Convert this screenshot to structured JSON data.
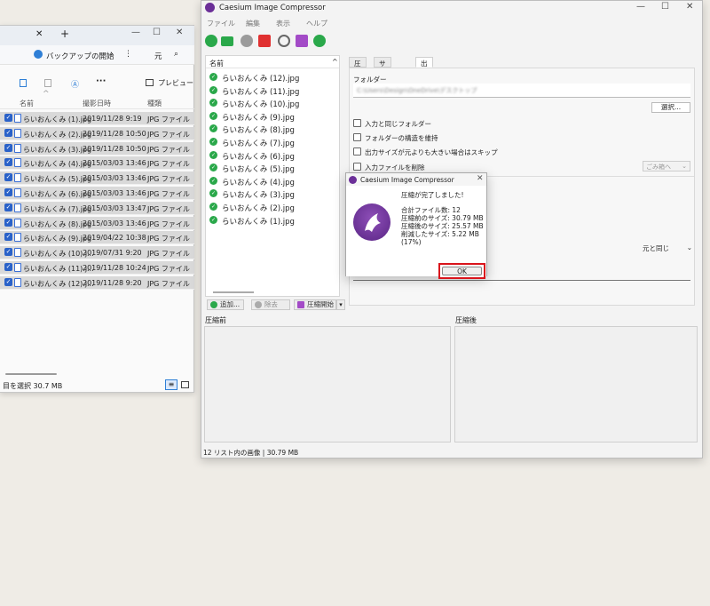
{
  "explorer": {
    "address_crumb": "バックアップの開始",
    "address_right": "元",
    "preview_label": "プレビュー",
    "toolbar_more": "···",
    "columns": [
      "名前",
      "撮影日時",
      "種類"
    ],
    "files": [
      {
        "name": "らいおんくみ (1).jpg",
        "date": "2019/11/28 9:19",
        "type": "JPG ファイル"
      },
      {
        "name": "らいおんくみ (2).jpg",
        "date": "2019/11/28 10:50",
        "type": "JPG ファイル"
      },
      {
        "name": "らいおんくみ (3).jpg",
        "date": "2019/11/28 10:50",
        "type": "JPG ファイル"
      },
      {
        "name": "らいおんくみ (4).jpg",
        "date": "2015/03/03 13:46",
        "type": "JPG ファイル"
      },
      {
        "name": "らいおんくみ (5).jpg",
        "date": "2015/03/03 13:46",
        "type": "JPG ファイル"
      },
      {
        "name": "らいおんくみ (6).jpg",
        "date": "2015/03/03 13:46",
        "type": "JPG ファイル"
      },
      {
        "name": "らいおんくみ (7).jpg",
        "date": "2015/03/03 13:47",
        "type": "JPG ファイル"
      },
      {
        "name": "らいおんくみ (8).jpg",
        "date": "2015/03/03 13:46",
        "type": "JPG ファイル"
      },
      {
        "name": "らいおんくみ (9).jpg",
        "date": "2019/04/22 10:38",
        "type": "JPG ファイル"
      },
      {
        "name": "らいおんくみ (10).j...",
        "date": "2019/07/31 9:20",
        "type": "JPG ファイル"
      },
      {
        "name": "らいおんくみ (11).j...",
        "date": "2019/11/28 10:24",
        "type": "JPG ファイル"
      },
      {
        "name": "らいおんくみ (12).j...",
        "date": "2019/11/28 9:20",
        "type": "JPG ファイル"
      }
    ],
    "status": "目を選択  30.7 MB"
  },
  "caesium": {
    "title": "Caesium Image Compressor",
    "menu": [
      "ファイル",
      "編集",
      "表示",
      "ヘルプ"
    ],
    "list_header": "名前",
    "list_items": [
      "らいおんくみ (12).jpg",
      "らいおんくみ (11).jpg",
      "らいおんくみ (10).jpg",
      "らいおんくみ (9).jpg",
      "らいおんくみ (8).jpg",
      "らいおんくみ (7).jpg",
      "らいおんくみ (6).jpg",
      "らいおんくみ (5).jpg",
      "らいおんくみ (4).jpg",
      "らいおんくみ (3).jpg",
      "らいおんくみ (2).jpg",
      "らいおんくみ (1).jpg"
    ],
    "btn_add": "追加...",
    "btn_remove": "除去",
    "btn_compress": "圧縮開始",
    "tabs": [
      "圧縮",
      "サイズ変更",
      "出力"
    ],
    "folder_label": "フォルダー",
    "folder_path": "C:\\Users\\Design\\OneDrive\\デスクトップ",
    "select_btn": "選択...",
    "checks": [
      "入力と同じフォルダー",
      "フォルダーの構造を維持",
      "出力サイズが元よりも大きい場合はスキップ",
      "入力ファイルを削除"
    ],
    "trash_select": "ごみ箱へ",
    "same_as_original": "元と同じ",
    "before_label": "圧縮前",
    "after_label": "圧縮後",
    "status": "12 リスト内の画像 | 30.79 MB"
  },
  "dialog": {
    "title": "Caesium Image Compressor",
    "message": "圧縮が完了しました!",
    "total": "合計ファイル数: 12",
    "before_size": "圧縮前のサイズ: 30.79 MB",
    "after_size": "圧縮後のサイズ: 25.57 MB",
    "reduced": "削減したサイズ: 5.22 MB (17%)",
    "ok": "OK"
  },
  "colors": {
    "accent_green": "#2aa84a",
    "brand_purple": "#6b2f98",
    "highlight_red": "#d9141c",
    "explorer_check": "#2a62c9"
  }
}
